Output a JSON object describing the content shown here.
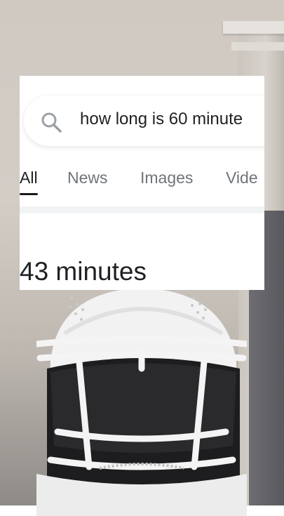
{
  "search": {
    "query": "how long is 60 minute"
  },
  "tabs": [
    {
      "label": "All",
      "active": true
    },
    {
      "label": "News",
      "active": false
    },
    {
      "label": "Images",
      "active": false
    },
    {
      "label": "Vide",
      "active": false
    }
  ],
  "result": {
    "answer": "43 minutes"
  },
  "icons": {
    "search": "search-icon"
  },
  "colors": {
    "card_bg": "#ffffff",
    "text": "#202124",
    "tab_inactive": "#70757a"
  }
}
